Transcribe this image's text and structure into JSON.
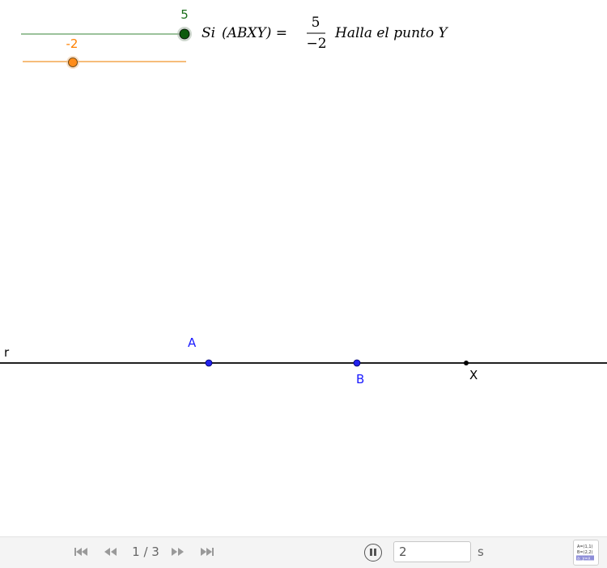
{
  "sliders": {
    "green": {
      "value_label": "5",
      "value": 5,
      "color": "#5a9a5a",
      "handle_color": "#1a5e1a"
    },
    "orange": {
      "value_label": "-2",
      "value": -2,
      "color": "#f6bd7a",
      "handle_color": "#ff8c1a"
    }
  },
  "formula": {
    "si": "Si",
    "ratio": "(ABXY) =",
    "numerator": "5",
    "denominator": "−2",
    "instruction": "Halla el punto Y"
  },
  "construction": {
    "line_label": "r",
    "points": {
      "A": {
        "label": "A",
        "color": "#1a1aff"
      },
      "B": {
        "label": "B",
        "color": "#1a1aff"
      },
      "X": {
        "label": "X",
        "color": "#000000"
      }
    }
  },
  "toolbar": {
    "step_counter": "1 / 3",
    "speed_value": "2",
    "speed_unit": "s",
    "algebra_icon_lines": [
      "A=(1,1)",
      "B=(2,2)",
      "a: y=x"
    ]
  }
}
